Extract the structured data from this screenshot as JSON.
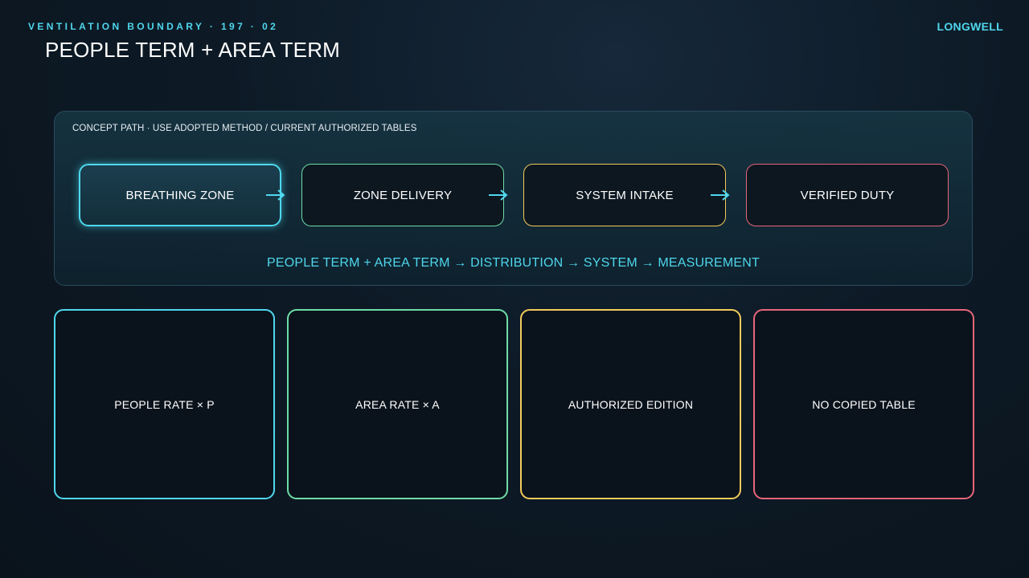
{
  "header": {
    "kicker": "VENTILATION BOUNDARY · 197 · 02",
    "title": "PEOPLE TERM + AREA TERM",
    "brand": "LONGWELL"
  },
  "panel": {
    "caption": "CONCEPT PATH · USE ADOPTED METHOD / CURRENT AUTHORIZED TABLES",
    "steps": [
      {
        "label": "BREATHING ZONE",
        "color": "#4fd8ee"
      },
      {
        "label": "ZONE DELIVERY",
        "color": "#6fdca6"
      },
      {
        "label": "SYSTEM INTAKE",
        "color": "#f2cb5a"
      },
      {
        "label": "VERIFIED DUTY",
        "color": "#e8657a"
      }
    ],
    "arrow_icon": "arrow-right-icon",
    "formula": "PEOPLE TERM + AREA TERM → DISTRIBUTION → SYSTEM → MEASUREMENT"
  },
  "cards": [
    {
      "label": "PEOPLE RATE × P",
      "color": "#4fd8ee"
    },
    {
      "label": "AREA RATE × A",
      "color": "#6fdca6"
    },
    {
      "label": "AUTHORIZED EDITION",
      "color": "#f2cb5a"
    },
    {
      "label": "NO COPIED TABLE",
      "color": "#e8657a"
    }
  ],
  "colors": {
    "accent": "#4fd6ec",
    "background": "#0d1a26"
  }
}
